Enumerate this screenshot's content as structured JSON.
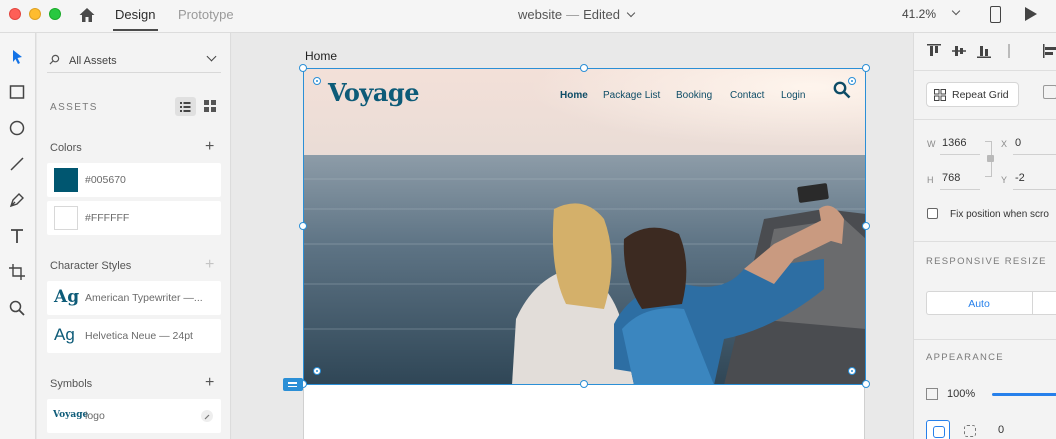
{
  "titlebar": {
    "tabs": [
      {
        "label": "Design",
        "active": true
      },
      {
        "label": "Prototype",
        "active": false
      }
    ],
    "document_name": "website",
    "document_separator": "—",
    "document_status": "Edited",
    "zoom": "41.2%"
  },
  "assets_panel": {
    "filter_label": "All Assets",
    "section_title": "ASSETS",
    "colors": {
      "title": "Colors",
      "items": [
        {
          "label": "#005670",
          "swatch": "#005670"
        },
        {
          "label": "#FFFFFF",
          "swatch": "#FFFFFF"
        }
      ]
    },
    "character_styles": {
      "title": "Character Styles",
      "items": [
        {
          "preview": "Ag",
          "label": "American Typewriter —..."
        },
        {
          "preview": "Ag",
          "label": "Helvetica Neue — 24pt"
        }
      ]
    },
    "symbols": {
      "title": "Symbols",
      "items": [
        {
          "preview": "Voyage",
          "label": "logo"
        }
      ]
    }
  },
  "canvas": {
    "artboard_label": "Home",
    "site": {
      "brand": "Voyage",
      "nav": [
        "Home",
        "Package List",
        "Booking",
        "Contact",
        "Login"
      ],
      "active_nav": "Home",
      "brand_color": "#005670"
    }
  },
  "inspector": {
    "repeat_grid_label": "Repeat Grid",
    "w_label": "W",
    "w_value": "1366",
    "x_label": "X",
    "x_value": "0",
    "h_label": "H",
    "h_value": "768",
    "y_label": "Y",
    "y_value": "-2",
    "fix_position_label": "Fix position when scro",
    "responsive_resize_title": "RESPONSIVE RESIZE",
    "auto_label": "Auto",
    "appearance_title": "APPEARANCE",
    "opacity": "100%",
    "corner_value": "0",
    "accent_color": "#2680eb"
  }
}
